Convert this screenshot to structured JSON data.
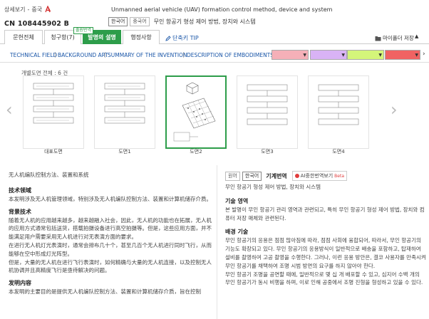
{
  "header": {
    "breadcrumb_detail": "상세보기",
    "breadcrumb_sep": "-",
    "breadcrumb_country": "중국",
    "publication_number": "CN 108445902 B",
    "title_en": "Unmanned aerial vehicle (UAV) formation control method, device and system",
    "lang_ko": "한국어",
    "lang_zh": "중국어",
    "title_ko": "무인 항공기 형성 제어 방법, 장치와 시스템"
  },
  "tabs": {
    "items": [
      "문헌전체",
      "청구항(7)",
      "발명의 설명",
      "행정사항"
    ],
    "active": 2,
    "badge": "출원번역"
  },
  "toolbar": {
    "tip_label": "단축키 TIP",
    "save_label": "마이폴더 저장",
    "scroll_up": "▲"
  },
  "section_nav": {
    "links": [
      "TECHNICAL FIELD",
      "BACKGROUND ART",
      "SUMMARY OF THE INVENTION",
      "DESCRIPTION OF EMBODIMENTS"
    ],
    "highlight_colors": [
      "#f5b0b8",
      "#d9b3f5",
      "#d4f57a",
      "#f06363"
    ]
  },
  "drawings": {
    "label": "개별도면 전체 : 6 건",
    "captions": [
      "대표도면",
      "도면1",
      "도면2",
      "도면3",
      "도면4"
    ],
    "selected": 2
  },
  "left": {
    "title": "无人机编队控制方法、装置和系统",
    "h_tech": "技术领域",
    "p_tech": "本发明涉及无人机管理领域，特别涉及无人机编队控制方法、装置和计算机储存介质。",
    "h_bg": "背景技术",
    "p_bg1": "随着无人机的应用越来越多，越来越融入社会，因此，无人机的功能也在拓展，无人机的应用方式通常包括送货，搭载拍摄设备进行高空拍摄等。但是，这些应用方面，并不能满足用户需要采用无人机进行对无表演方面的要求。",
    "p_bg2": "在进行无人机灯光表演时，通常会排布几十个，甚至几百个无人机进行同时飞行，从而能够在空中形成灯光阵型。",
    "p_bg3": "但是，大量的无人机在进行飞行表演时，如何精确与大量的无人机连接，以及控制无人机协调并且高精度飞行是亟待解决的问题。",
    "h_content": "发明内容",
    "p_content": "本发明的主要目的是提供无人机编队控制方法、装置和计算机储存介质，旨在控制"
  },
  "right": {
    "btn_orig": "원어",
    "btn_ko": "한국어",
    "trans_title": "기계번역",
    "papago_label": "AI중한번역보기",
    "papago_badge": "Beta",
    "title": "무인 항공기 형성 제어 방법, 장치와 시스템",
    "h_tech": "기술 영역",
    "p_tech": "본 발명이 무인 항공기 관리 영역과 관련되고, 특히 무인 항공기 형성 제어 방법, 장치와 컴퓨터 저장 매체와 관련된다.",
    "h_bg": "배경 기술",
    "p_bg1": "무인 항공기의 응용은 점점 많아짐에 따라, 점점 사회에 융합되어, 따라서, 무인 항공기의 기능도 확장되고 있다. 무인 항공기의 응용방식이 일반적으로 배송을 포함하고, 탑재하여 설비를 촬영하여 고공 촬영을 수행한다. 그러나, 이런 응용 방안은, 결코 사용자를 만족시켜 무인 항공기를 채택하여 조명 시범 방면의 요구를 하지 않아야 한다.",
    "p_bg2": "무인 항공기 조명을 공연할 때에, 일반적으로 몇 십 개 배포할 수 있고, 심지어 수백 개의 무인 항공기가 동시 비행을 하며, 이로 인해 공중에서 조명 진형을 형성하고 있을 수 있다."
  }
}
